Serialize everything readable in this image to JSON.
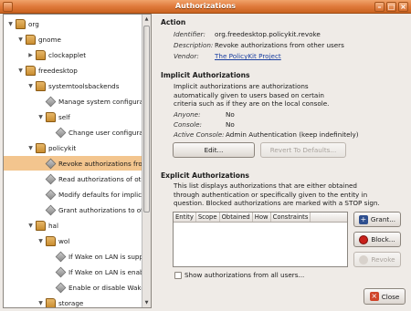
{
  "window": {
    "title": "Authorizations"
  },
  "tree": {
    "items": [
      {
        "label": "org",
        "expanded": true,
        "kind": "folder",
        "indent": 0
      },
      {
        "label": "gnome",
        "expanded": true,
        "kind": "folder",
        "indent": 1
      },
      {
        "label": "clockapplet",
        "expanded": false,
        "kind": "folder",
        "indent": 2
      },
      {
        "label": "freedesktop",
        "expanded": true,
        "kind": "folder",
        "indent": 1
      },
      {
        "label": "systemtoolsbackends",
        "expanded": true,
        "kind": "folder",
        "indent": 2
      },
      {
        "label": "Manage system configuratio",
        "kind": "action",
        "indent": 3
      },
      {
        "label": "self",
        "expanded": true,
        "kind": "folder",
        "indent": 3
      },
      {
        "label": "Change user configuratio",
        "kind": "action",
        "indent": 4
      },
      {
        "label": "policykit",
        "expanded": true,
        "kind": "folder",
        "indent": 2
      },
      {
        "label": "Revoke authorizations from",
        "kind": "action",
        "indent": 3,
        "selected": true
      },
      {
        "label": "Read authorizations of other",
        "kind": "action",
        "indent": 3
      },
      {
        "label": "Modify defaults for implicit a",
        "kind": "action",
        "indent": 3
      },
      {
        "label": "Grant authorizations to othe",
        "kind": "action",
        "indent": 3
      },
      {
        "label": "hal",
        "expanded": true,
        "kind": "folder",
        "indent": 2
      },
      {
        "label": "wol",
        "expanded": true,
        "kind": "folder",
        "indent": 3
      },
      {
        "label": "If Wake on LAN is support",
        "kind": "action",
        "indent": 4
      },
      {
        "label": "If Wake on LAN is enabled",
        "kind": "action",
        "indent": 4
      },
      {
        "label": "Enable or disable Wake o",
        "kind": "action",
        "indent": 4
      },
      {
        "label": "storage",
        "expanded": true,
        "kind": "folder",
        "indent": 3
      }
    ]
  },
  "action": {
    "heading": "Action",
    "identifier_label": "Identifier:",
    "identifier_value": "org.freedesktop.policykit.revoke",
    "description_label": "Description:",
    "description_value": "Revoke authorizations from other users",
    "vendor_label": "Vendor:",
    "vendor_value": "The PolicyKit Project"
  },
  "implicit": {
    "heading": "Implicit Authorizations",
    "text_1": "Implicit authorizations are authorizations",
    "text_2": "automatically given to users based on certain",
    "text_3": "criteria such as if they are on the local console.",
    "anyone_label": "Anyone:",
    "anyone_value": "No",
    "console_label": "Console:",
    "console_value": "No",
    "active_label": "Active Console:",
    "active_value": "Admin Authentication (keep indefinitely)",
    "edit_label": "Edit...",
    "revert_label": "Revert To Defaults..."
  },
  "explicit": {
    "heading": "Explicit Authorizations",
    "text_1": "This list displays authorizations that are either obtained",
    "text_2": "through authentication or specifically given to the entity in",
    "text_3": "question. Blocked authorizations are marked with a STOP sign.",
    "columns": [
      "Entity",
      "Scope",
      "Obtained",
      "How",
      "Constraints"
    ],
    "grant_label": "Grant...",
    "block_label": "Block...",
    "revoke_label": "Revoke",
    "show_all_label": "Show authorizations from all users..."
  },
  "footer": {
    "close_label": "Close"
  },
  "colors": {
    "titlebar": "#e07a3c",
    "selection": "#f3c58e",
    "link": "#1b3fa0"
  }
}
